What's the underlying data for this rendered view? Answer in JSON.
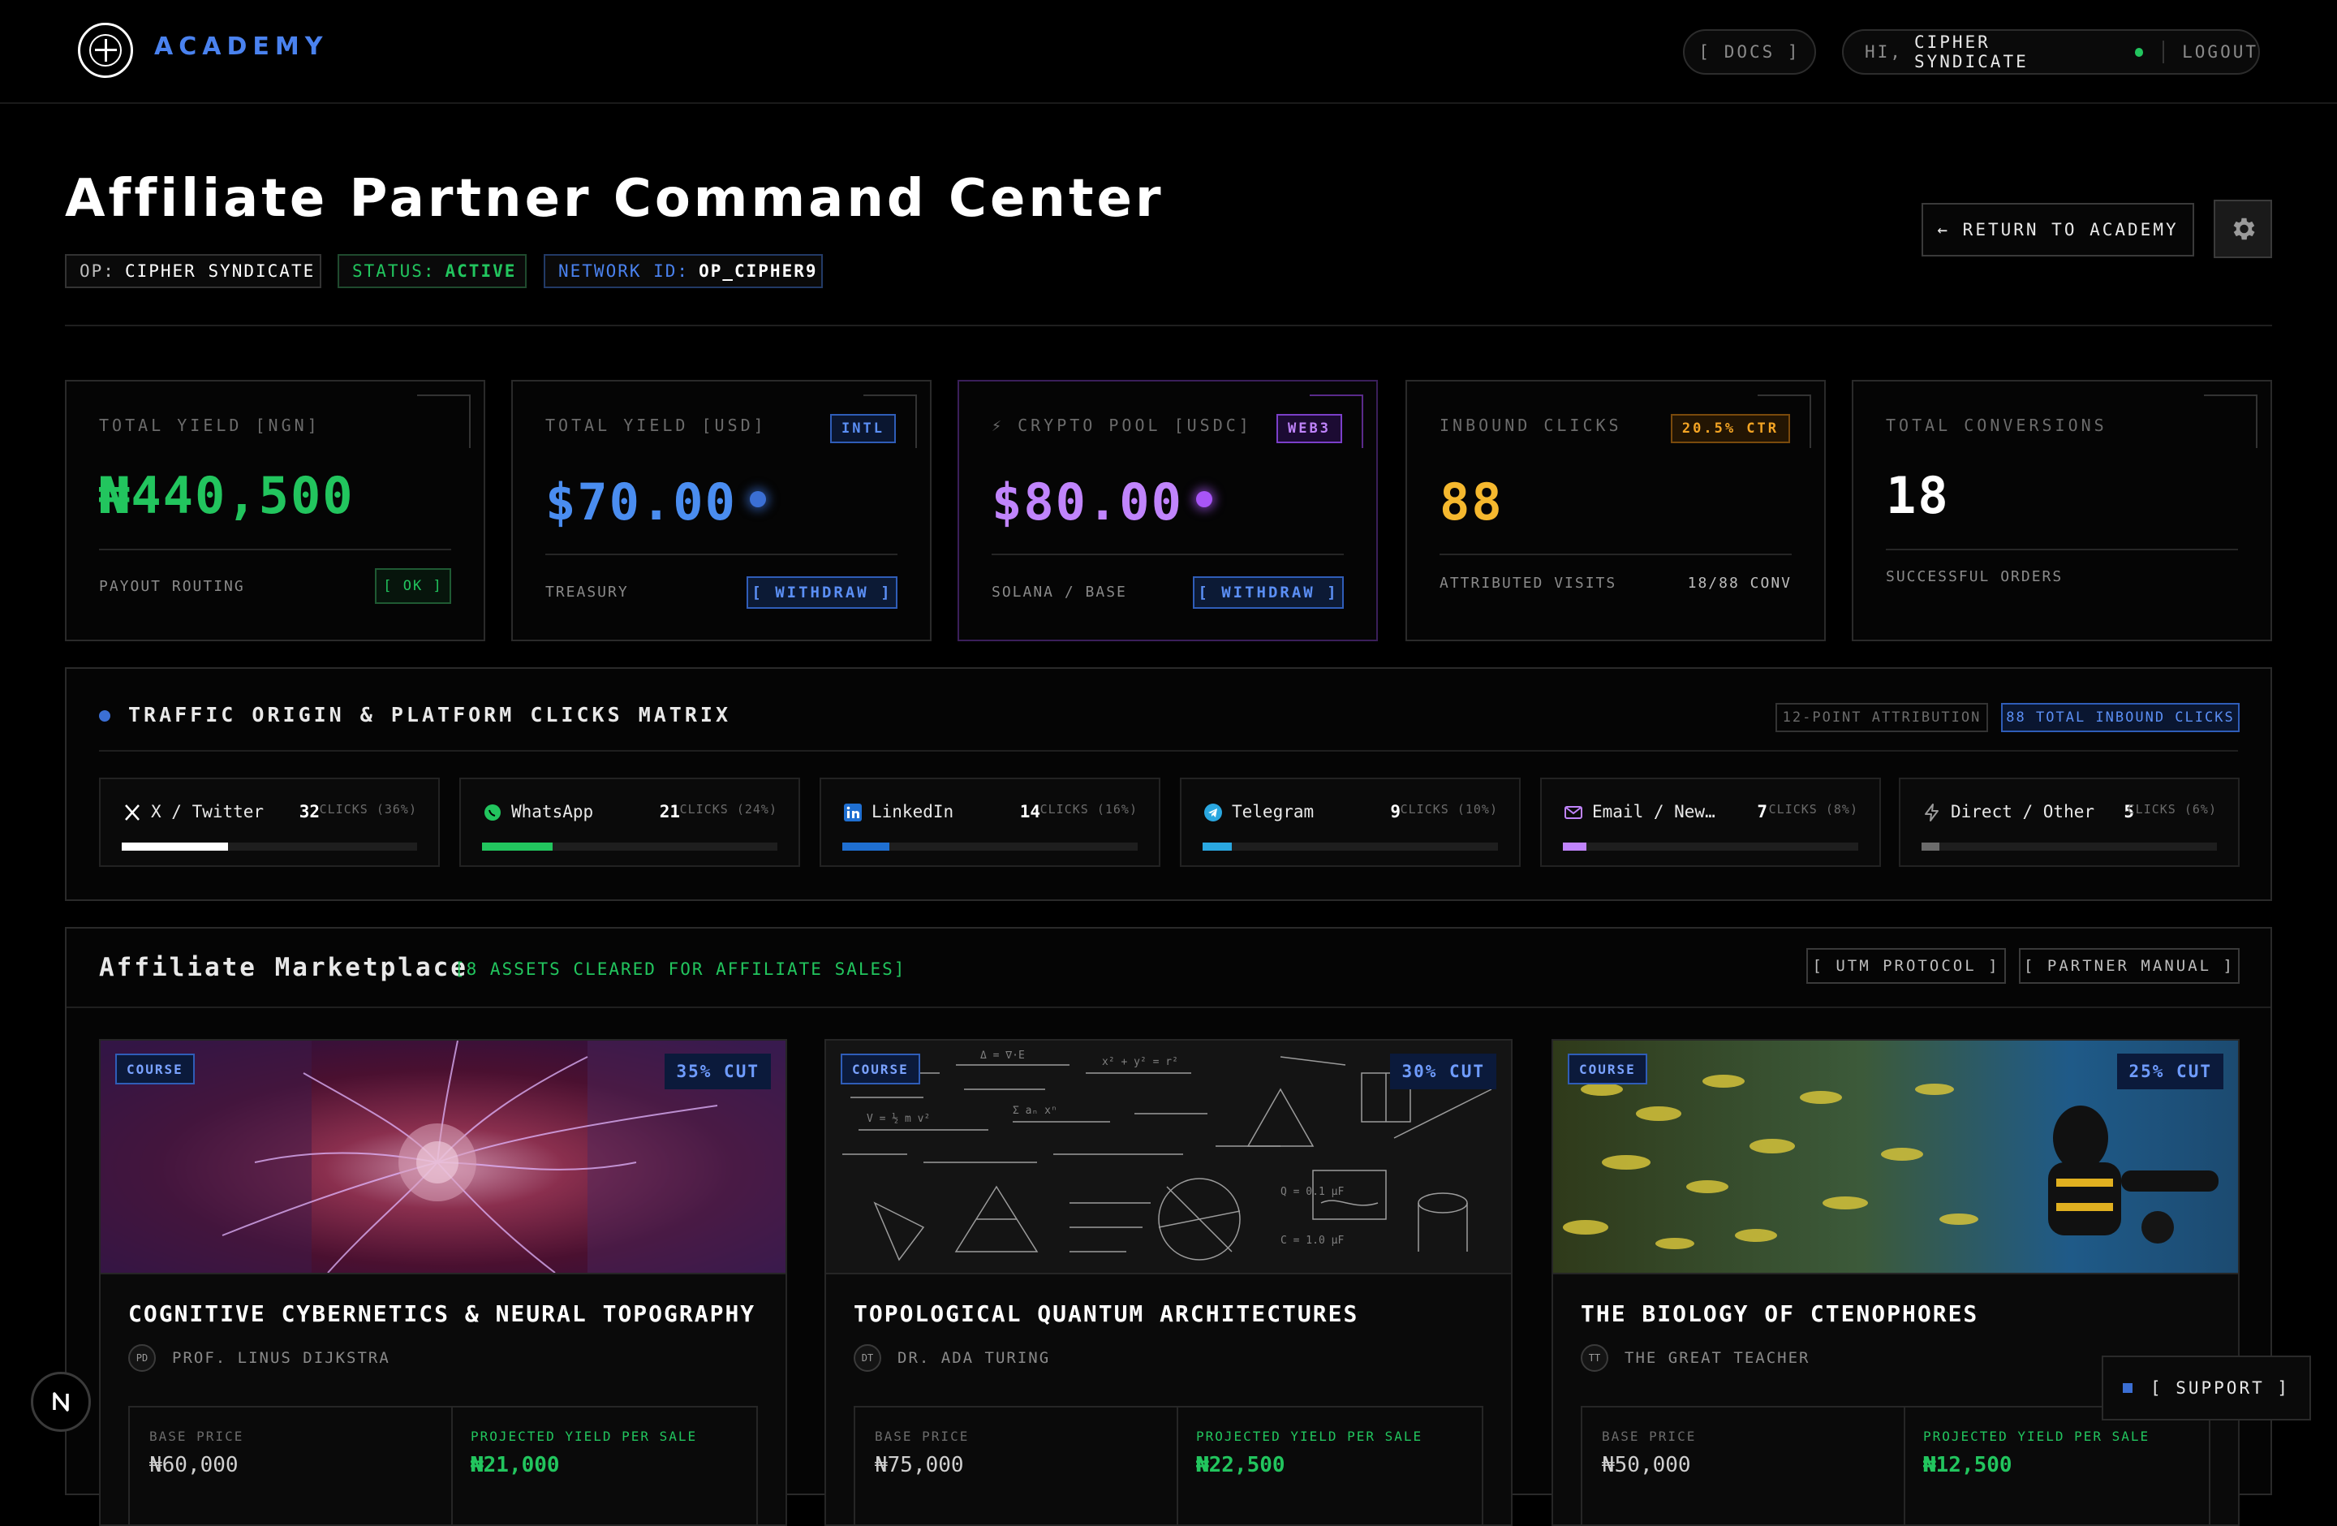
{
  "nav": {
    "brand": "ACADEMY",
    "docs_label": "[ DOCS ]",
    "greeting": "HI,",
    "user_name": "CIPHER SYNDICATE",
    "logout_label": "LOGOUT"
  },
  "header": {
    "title": "Affiliate Partner Command Center",
    "op_key": "OP:",
    "op_value": "CIPHER SYNDICATE",
    "status_key": "STATUS:",
    "status_value": "ACTIVE",
    "network_key": "NETWORK ID:",
    "network_value": "OP_CIPHER9",
    "return_label": "← RETURN TO ACADEMY"
  },
  "stats": {
    "ngn": {
      "label": "TOTAL YIELD [NGN]",
      "value": "₦440,500",
      "footer": "PAYOUT ROUTING",
      "button": "[ OK ]"
    },
    "usd": {
      "label": "TOTAL YIELD [USD]",
      "badge": "INTL",
      "value": "$70.00",
      "footer": "TREASURY",
      "button": "[ WITHDRAW ]"
    },
    "crypto": {
      "label": "⚡ CRYPTO POOL [USDC]",
      "badge": "WEB3",
      "value": "$80.00",
      "footer": "SOLANA / BASE",
      "button": "[ WITHDRAW ]"
    },
    "clicks": {
      "label": "INBOUND CLICKS",
      "badge": "20.5% CTR",
      "value": "88",
      "footer": "ATTRIBUTED VISITS",
      "footer_right": "18/88 CONV"
    },
    "conversions": {
      "label": "TOTAL CONVERSIONS",
      "value": "18",
      "footer": "SUCCESSFUL ORDERS"
    }
  },
  "colors": {
    "accent_blue": "#4a82ef",
    "green": "#22c55e",
    "purple": "#c084fc",
    "amber": "#f5b82e"
  },
  "traffic": {
    "title": "TRAFFIC ORIGIN & PLATFORM CLICKS MATRIX",
    "attribution_label": "12-POINT ATTRIBUTION",
    "total_label": "88 TOTAL INBOUND CLICKS",
    "sources": [
      {
        "name": "X / Twitter",
        "icon": "x-twitter-icon",
        "count": "32",
        "clicks": "CLICKS (36%)",
        "share": 0.36,
        "color": "#ffffff"
      },
      {
        "name": "WhatsApp",
        "icon": "whatsapp-icon",
        "count": "21",
        "clicks": "CLICKS (24%)",
        "share": 0.24,
        "color": "#22c55e"
      },
      {
        "name": "LinkedIn",
        "icon": "linkedin-icon",
        "count": "14",
        "clicks": "CLICKS (16%)",
        "share": 0.16,
        "color": "#1f6fd1"
      },
      {
        "name": "Telegram",
        "icon": "telegram-icon",
        "count": "9",
        "clicks": "CLICKS (10%)",
        "share": 0.1,
        "color": "#2aa7e0"
      },
      {
        "name": "Email / Newsletter",
        "icon": "mail-icon",
        "count": "7",
        "clicks": "CLICKS (8%)",
        "share": 0.08,
        "color": "#c084fc"
      },
      {
        "name": "Direct / Other",
        "icon": "lightning-icon",
        "count": "5",
        "clicks": "CLICKS (6%)",
        "share": 0.06,
        "color": "#6b6b6b"
      }
    ]
  },
  "market": {
    "title": "Affiliate Marketplace",
    "subtitle": "[8 ASSETS CLEARED FOR AFFILIATE SALES]",
    "utm_label": "[ UTM PROTOCOL ]",
    "manual_label": "[ PARTNER MANUAL ]",
    "courses": [
      {
        "tag": "COURSE",
        "cut": "35% CUT",
        "title": "COGNITIVE CYBERNETICS & NEURAL TOPOGRAPHY",
        "initials": "PD",
        "author": "PROF. LINUS DIJKSTRA",
        "base_label": "BASE PRICE",
        "base_price": "₦60,000",
        "yield_label": "PROJECTED YIELD PER SALE",
        "yield_value": "₦21,000"
      },
      {
        "tag": "COURSE",
        "cut": "30% CUT",
        "title": "TOPOLOGICAL QUANTUM ARCHITECTURES",
        "initials": "DT",
        "author": "DR. ADA TURING",
        "base_label": "BASE PRICE",
        "base_price": "₦75,000",
        "yield_label": "PROJECTED YIELD PER SALE",
        "yield_value": "₦22,500"
      },
      {
        "tag": "COURSE",
        "cut": "25% CUT",
        "title": "THE BIOLOGY OF CTENOPHORES",
        "initials": "TT",
        "author": "THE GREAT TEACHER",
        "base_label": "BASE PRICE",
        "base_price": "₦50,000",
        "yield_label": "PROJECTED YIELD PER SALE",
        "yield_value": "₦12,500"
      }
    ]
  },
  "support_label": "[ SUPPORT ]"
}
